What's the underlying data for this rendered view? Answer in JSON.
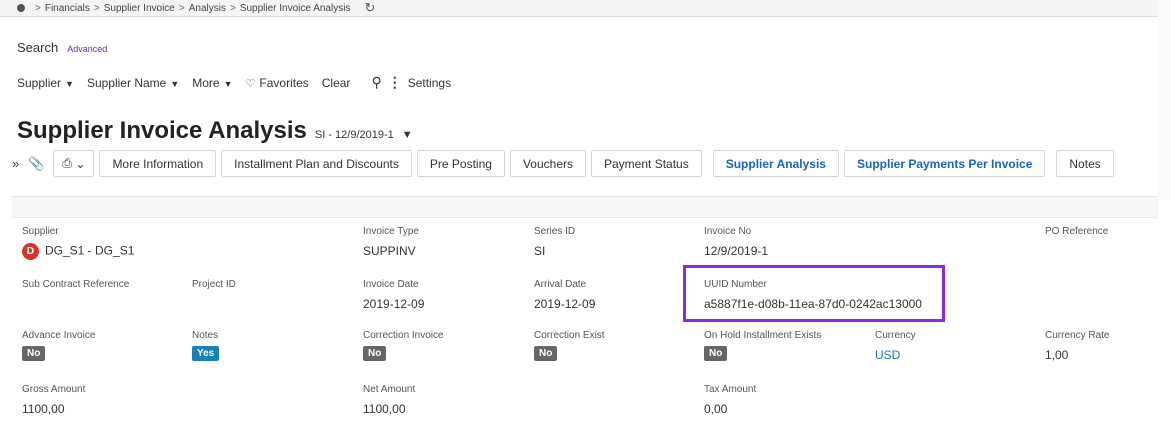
{
  "breadcrumb": [
    "Financials",
    "Supplier Invoice",
    "Analysis",
    "Supplier Invoice Analysis"
  ],
  "search": {
    "label": "Search",
    "advanced": "Advanced"
  },
  "filters": {
    "supplier": "Supplier",
    "supplier_name": "Supplier Name",
    "more": "More",
    "favorites": "Favorites",
    "clear": "Clear",
    "settings": "Settings"
  },
  "page": {
    "title": "Supplier Invoice Analysis",
    "record": "SI - 12/9/2019-1"
  },
  "tabs": [
    "More Information",
    "Installment Plan and Discounts",
    "Pre Posting",
    "Vouchers",
    "Payment Status",
    "Supplier Analysis",
    "Supplier Payments Per Invoice",
    "Notes"
  ],
  "fields": {
    "supplier": {
      "label": "Supplier",
      "value": "DG_S1 - DG_S1",
      "avatar": "D"
    },
    "invoice_type": {
      "label": "Invoice Type",
      "value": "SUPPINV"
    },
    "series_id": {
      "label": "Series ID",
      "value": "SI"
    },
    "invoice_no": {
      "label": "Invoice No",
      "value": "12/9/2019-1"
    },
    "po_reference": {
      "label": "PO Reference",
      "value": ""
    },
    "sub_contract_reference": {
      "label": "Sub Contract Reference"
    },
    "project_id": {
      "label": "Project ID"
    },
    "invoice_date": {
      "label": "Invoice Date",
      "value": "2019-12-09"
    },
    "arrival_date": {
      "label": "Arrival Date",
      "value": "2019-12-09"
    },
    "uuid_number": {
      "label": "UUID Number",
      "value": "a5887f1e-d08b-11ea-87d0-0242ac13000"
    },
    "advance_invoice": {
      "label": "Advance Invoice",
      "value": "No"
    },
    "notes": {
      "label": "Notes",
      "value": "Yes"
    },
    "correction_invoice": {
      "label": "Correction Invoice",
      "value": "No"
    },
    "correction_exist": {
      "label": "Correction Exist",
      "value": "No"
    },
    "on_hold_installment_exists": {
      "label": "On Hold Installment Exists",
      "value": "No"
    },
    "currency": {
      "label": "Currency",
      "value": "USD"
    },
    "currency_rate": {
      "label": "Currency Rate",
      "value": "1,00"
    },
    "gross_amount": {
      "label": "Gross Amount",
      "value": "1100,00"
    },
    "net_amount": {
      "label": "Net Amount",
      "value": "1100,00"
    },
    "tax_amount": {
      "label": "Tax Amount",
      "value": "0,00"
    }
  },
  "colors": {
    "highlight": "#8a2be2",
    "link": "#1a6fbf",
    "avatar": "#d8352a",
    "badge_yes": "#1b7fb8"
  }
}
